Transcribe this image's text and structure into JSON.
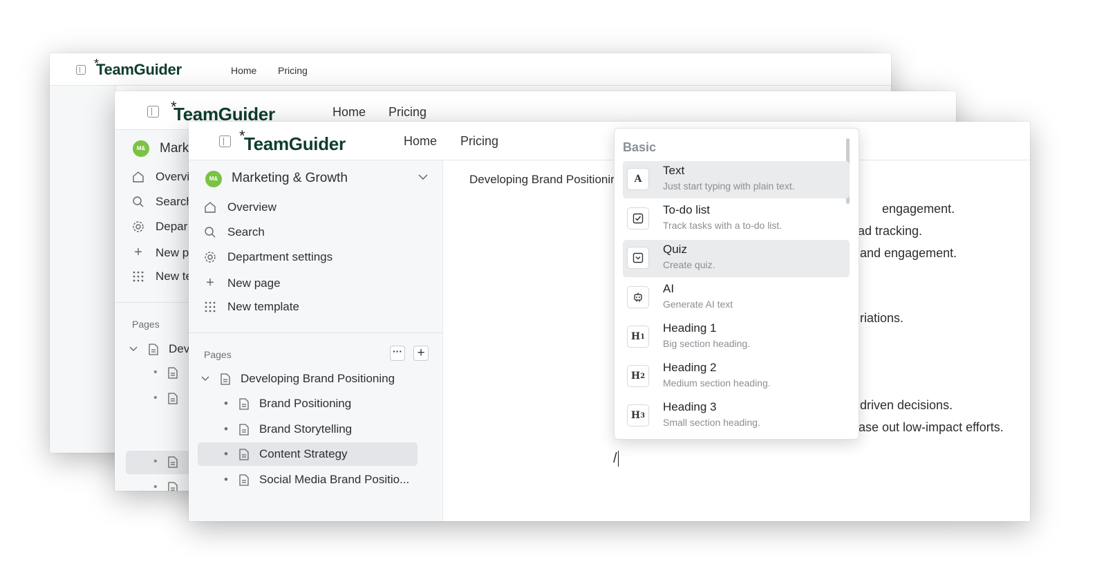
{
  "app": {
    "logo_text": "TeamGuider",
    "logo_spark": "*",
    "nav": {
      "home": "Home",
      "pricing": "Pricing"
    }
  },
  "sidebar": {
    "workspace": {
      "avatar": "M&",
      "name": "Marketing & Growth"
    },
    "menu": {
      "overview": "Overview",
      "search": "Search",
      "department_settings": "Department settings",
      "new_page": "New page",
      "new_template": "New template"
    },
    "pages_label": "Pages",
    "tree": {
      "root": "Developing Brand Positioning",
      "children": [
        "Brand Positioning",
        "Brand Storytelling",
        "Content Strategy",
        "Social Media Brand Positio..."
      ]
    },
    "back": {
      "mid_menu": [
        "Overvi",
        "Search",
        "Depar",
        "New p",
        "New te"
      ],
      "mid_name": "Mark",
      "mid_tree_root": "Dev"
    }
  },
  "document": {
    "title": "Developing Brand Positionir",
    "lines": [
      "engagement.",
      "ad tracking.",
      "and engagement.",
      "riations.",
      "driven decisions.",
      "ase out low-impact efforts."
    ],
    "slash": "/"
  },
  "command_menu": {
    "section": "Basic",
    "items": [
      {
        "title": "Text",
        "desc": "Just start typing with plain text.",
        "icon": "text-icon"
      },
      {
        "title": "To-do list",
        "desc": "Track tasks with a to-do list.",
        "icon": "checkbox-icon"
      },
      {
        "title": "Quiz",
        "desc": "Create quiz.",
        "icon": "quiz-icon"
      },
      {
        "title": "AI",
        "desc": "Generate AI text",
        "icon": "robot-icon"
      },
      {
        "title": "Heading 1",
        "desc": "Big section heading.",
        "icon": "h1-icon"
      },
      {
        "title": "Heading 2",
        "desc": "Medium section heading.",
        "icon": "h2-icon"
      },
      {
        "title": "Heading 3",
        "desc": "Small section heading.",
        "icon": "h3-icon"
      }
    ]
  },
  "colors": {
    "brand": "#0f3d2e",
    "avatar": "#7cc243",
    "highlight": "#e9ebed"
  }
}
